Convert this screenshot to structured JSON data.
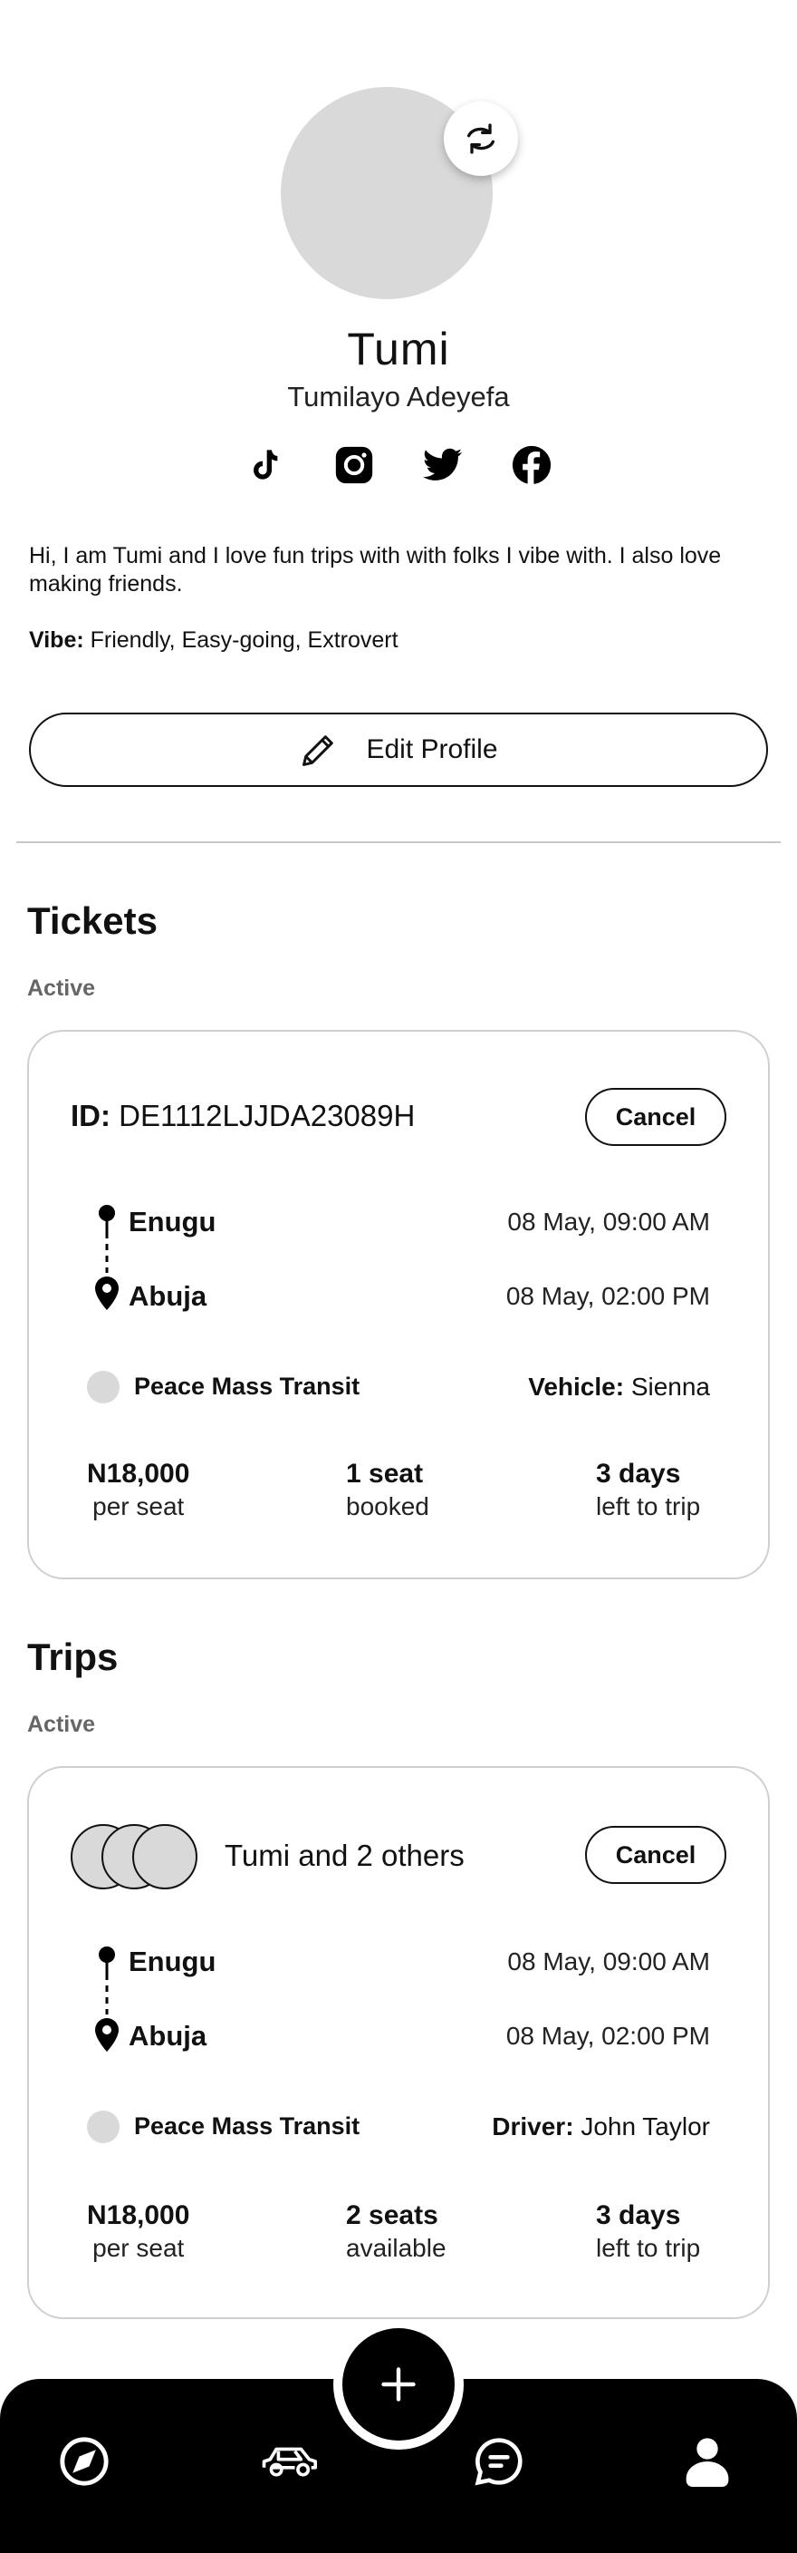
{
  "profile": {
    "display_name": "Tumi",
    "full_name": "Tumilayo Adeyefa",
    "bio": "Hi,  I am Tumi and I love fun trips with with folks I vibe with. I  also love making friends.",
    "vibe_label": "Vibe:",
    "vibe_value": "Friendly, Easy-going, Extrovert",
    "edit_label": "Edit Profile",
    "socials": [
      "tiktok-icon",
      "instagram-icon",
      "twitter-icon",
      "facebook-icon"
    ]
  },
  "tickets": {
    "title": "Tickets",
    "subtitle": "Active",
    "card": {
      "id_label": "ID:",
      "id_value": "DE1112LJJDA23089H",
      "cancel_label": "Cancel",
      "from_city": "Enugu",
      "from_time": "08 May, 09:00 AM",
      "to_city": "Abuja",
      "to_time": "08 May, 02:00 PM",
      "operator": "Peace Mass Transit",
      "vehicle_label": "Vehicle:",
      "vehicle_value": "Sienna",
      "price": "N18,000",
      "price_sub": "per seat",
      "seats": "1 seat",
      "seats_sub": "booked",
      "days": "3 days",
      "days_sub": "left to trip"
    }
  },
  "trips": {
    "title": "Trips",
    "subtitle": "Active",
    "card": {
      "people": "Tumi and 2 others",
      "cancel_label": "Cancel",
      "from_city": "Enugu",
      "from_time": "08 May, 09:00 AM",
      "to_city": "Abuja",
      "to_time": "08 May, 02:00 PM",
      "operator": "Peace Mass Transit",
      "driver_label": "Driver:",
      "driver_value": "John Taylor",
      "price": "N18,000",
      "price_sub": "per seat",
      "seats": "2 seats",
      "seats_sub": "available",
      "days": "3 days",
      "days_sub": "left to trip"
    }
  },
  "nav": {
    "items": [
      "explore-icon",
      "car-icon",
      "chat-icon",
      "profile-icon"
    ],
    "fab": "plus-icon"
  },
  "colors": {
    "placeholder": "#d9d9d9",
    "nav_bg": "#000000",
    "border": "#cfcfcf"
  }
}
